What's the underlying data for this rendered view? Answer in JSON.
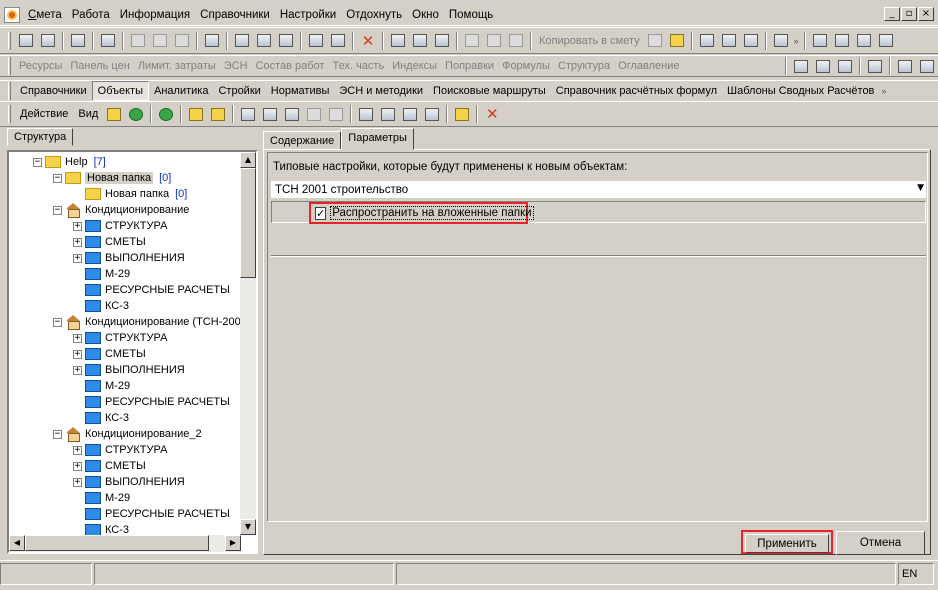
{
  "menubar": {
    "items": [
      {
        "label": "Смета",
        "underline": "С"
      },
      {
        "label": "Работа"
      },
      {
        "label": "Информация"
      },
      {
        "label": "Справочники"
      },
      {
        "label": "Настройки"
      },
      {
        "label": "Отдохнуть"
      },
      {
        "label": "Окно"
      },
      {
        "label": "Помощь"
      }
    ],
    "window_buttons": [
      "_",
      "▫",
      "×"
    ]
  },
  "toolbar1": {
    "copy_to_estimate": "Копировать в смету"
  },
  "toolbar2": {
    "items": [
      "Ресурсы",
      "Панель цен",
      "Лимит. затраты",
      "ЭСН",
      "Состав работ",
      "Тех. часть",
      "Индексы",
      "Поправки",
      "Формулы",
      "Структура",
      "Оглавление"
    ]
  },
  "toolbar3": {
    "items": [
      "Справочники",
      "Объекты",
      "Аналитика",
      "Стройки",
      "Нормативы",
      "ЭСН и методики",
      "Поисковые маршруты",
      "Справочник расчётных формул",
      "Шаблоны Сводных Расчётов"
    ],
    "active": "Объекты"
  },
  "toolbar4": {
    "action": "Действие",
    "view": "Вид"
  },
  "left_panel": {
    "tab": "Структура",
    "tree": [
      {
        "label": "Help",
        "count": "[7]",
        "icon": "folder-icon",
        "level": 0,
        "toggle": "−"
      },
      {
        "label": "Новая папка",
        "count": "[0]",
        "icon": "folder-open-icon",
        "level": 1,
        "toggle": "−",
        "selected": true
      },
      {
        "label": "Новая папка",
        "count": "[0]",
        "icon": "folder-icon",
        "level": 2,
        "toggle": ""
      },
      {
        "label": "Кондиционирование",
        "icon": "house-icon",
        "level": 1,
        "toggle": "−"
      },
      {
        "label": "СТРУКТУРА",
        "icon": "blue-folder-icon",
        "level": 2,
        "toggle": "+"
      },
      {
        "label": "СМЕТЫ",
        "icon": "blue-folder-icon",
        "level": 2,
        "toggle": "+"
      },
      {
        "label": "ВЫПОЛНЕНИЯ",
        "icon": "blue-folder-icon",
        "level": 2,
        "toggle": "+"
      },
      {
        "label": "М-29",
        "icon": "blue-folder-icon",
        "level": 2,
        "toggle": ""
      },
      {
        "label": "РЕСУРСНЫЕ РАСЧЕТЫ",
        "icon": "blue-folder-icon",
        "level": 2,
        "toggle": ""
      },
      {
        "label": "КС-3",
        "icon": "blue-folder-icon",
        "level": 2,
        "toggle": ""
      },
      {
        "label": "Кондиционирование (ТСН-200",
        "icon": "house-icon",
        "level": 1,
        "toggle": "−"
      },
      {
        "label": "СТРУКТУРА",
        "icon": "blue-folder-icon",
        "level": 2,
        "toggle": "+"
      },
      {
        "label": "СМЕТЫ",
        "icon": "blue-folder-icon",
        "level": 2,
        "toggle": "+"
      },
      {
        "label": "ВЫПОЛНЕНИЯ",
        "icon": "blue-folder-icon",
        "level": 2,
        "toggle": "+"
      },
      {
        "label": "М-29",
        "icon": "blue-folder-icon",
        "level": 2,
        "toggle": ""
      },
      {
        "label": "РЕСУРСНЫЕ РАСЧЕТЫ",
        "icon": "blue-folder-icon",
        "level": 2,
        "toggle": ""
      },
      {
        "label": "КС-3",
        "icon": "blue-folder-icon",
        "level": 2,
        "toggle": ""
      },
      {
        "label": "Кондиционирование_2",
        "icon": "house-icon",
        "level": 1,
        "toggle": "−"
      },
      {
        "label": "СТРУКТУРА",
        "icon": "blue-folder-icon",
        "level": 2,
        "toggle": "+"
      },
      {
        "label": "СМЕТЫ",
        "icon": "blue-folder-icon",
        "level": 2,
        "toggle": "+"
      },
      {
        "label": "ВЫПОЛНЕНИЯ",
        "icon": "blue-folder-icon",
        "level": 2,
        "toggle": "+"
      },
      {
        "label": "М-29",
        "icon": "blue-folder-icon",
        "level": 2,
        "toggle": ""
      },
      {
        "label": "РЕСУРСНЫЕ РАСЧЕТЫ",
        "icon": "blue-folder-icon",
        "level": 2,
        "toggle": ""
      },
      {
        "label": "КС-3",
        "icon": "blue-folder-icon",
        "level": 2,
        "toggle": ""
      }
    ]
  },
  "right_panel": {
    "tabs": [
      "Содержание",
      "Параметры"
    ],
    "active_tab": "Параметры",
    "label": "Типовые настройки, которые будут применены к новым объектам:",
    "standard_value": "ТСН 2001 строительство",
    "propagate_label": "Распространить на вложенные папки",
    "propagate_checked": true,
    "apply_label": "Применить",
    "cancel_label": "Отмена"
  },
  "statusbar": {
    "lang": "EN"
  },
  "colors": {
    "highlight": "#e8242a",
    "count_blue": "#0a35b5"
  }
}
